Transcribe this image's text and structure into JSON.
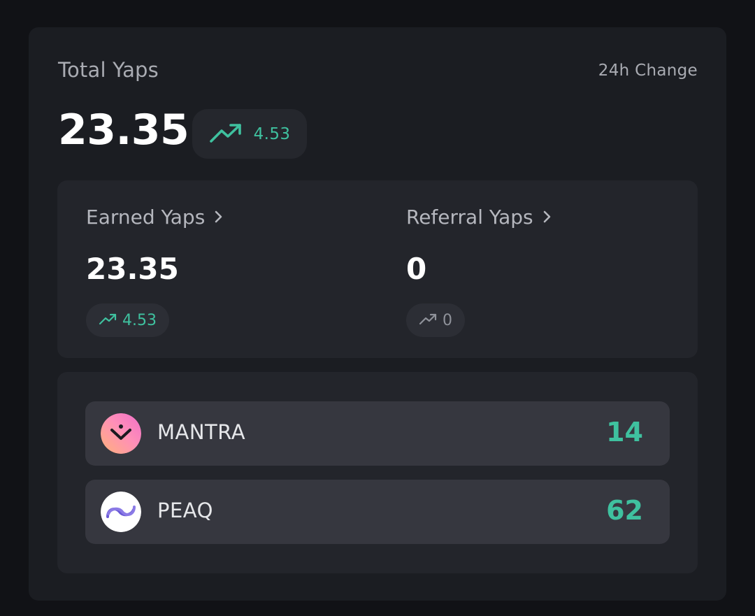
{
  "header": {
    "title": "Total Yaps",
    "change_label": "24h Change"
  },
  "total": {
    "value": "23.35",
    "change": "4.53"
  },
  "breakdown": {
    "earned": {
      "label": "Earned Yaps",
      "value": "23.35",
      "change": "4.53"
    },
    "referral": {
      "label": "Referral Yaps",
      "value": "0",
      "change": "0"
    }
  },
  "projects": [
    {
      "name": "MANTRA",
      "value": "14",
      "icon": "mantra-logo-icon"
    },
    {
      "name": "PEAQ",
      "value": "62",
      "icon": "peaq-logo-icon"
    }
  ],
  "colors": {
    "positive": "#3fc19f",
    "neutral": "#8f929a"
  }
}
